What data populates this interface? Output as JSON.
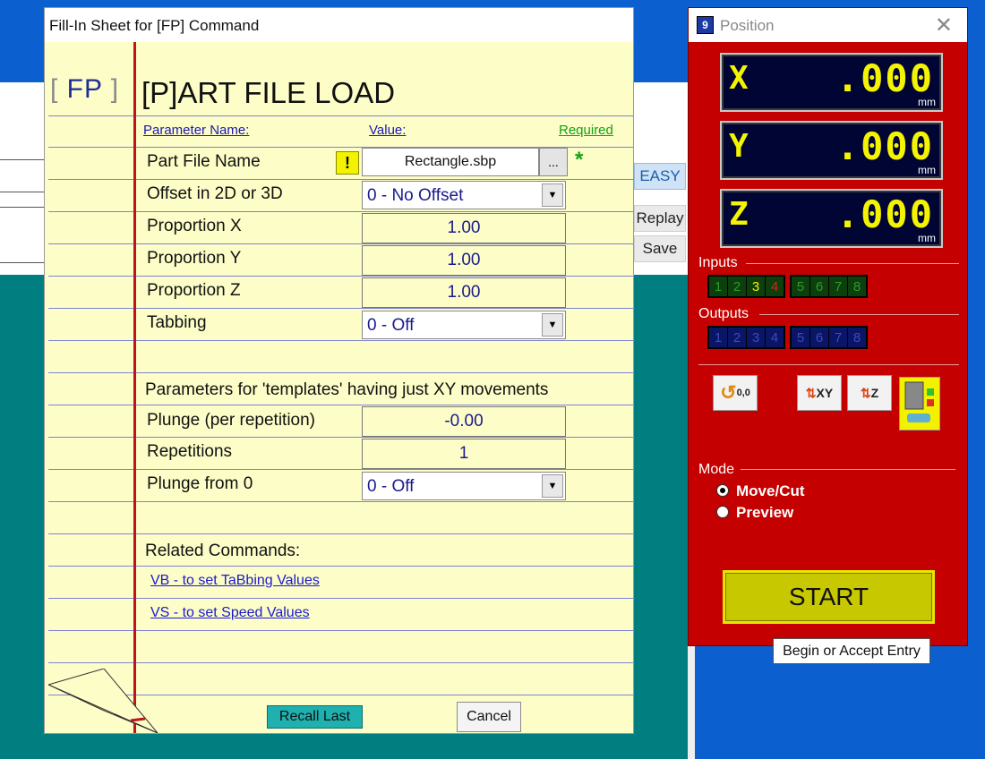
{
  "background_app": {
    "buttons": [
      "EASY",
      "Replay",
      "Save"
    ]
  },
  "fill_in": {
    "window_title": "Fill-In Sheet for [FP] Command",
    "tag": "FP",
    "heading": "[P]ART FILE LOAD",
    "columns": {
      "parameter": "Parameter Name:",
      "value": "Value:",
      "required": "Required"
    },
    "part_file": {
      "label": "Part File Name",
      "value": "Rectangle.sbp",
      "browse": "...",
      "required_mark": "*",
      "warning": "!"
    },
    "offset": {
      "label": "Offset in 2D or 3D",
      "value": "0 - No Offset"
    },
    "proportion_x": {
      "label": "Proportion X",
      "value": "1.00"
    },
    "proportion_y": {
      "label": "Proportion Y",
      "value": "1.00"
    },
    "proportion_z": {
      "label": "Proportion Z",
      "value": "1.00"
    },
    "tabbing": {
      "label": "Tabbing",
      "value": "0 - Off"
    },
    "templates_note": "Parameters for 'templates' having just XY movements",
    "plunge": {
      "label": "Plunge (per repetition)",
      "value": "-0.00"
    },
    "repetitions": {
      "label": "Repetitions",
      "value": "1"
    },
    "plunge_from_0": {
      "label": "Plunge from 0",
      "value": "0 - Off"
    },
    "related_heading": "Related Commands:",
    "links": [
      "VB - to set TaBbing Values",
      "VS - to set Speed Values"
    ],
    "recall_button": "Recall Last",
    "cancel_button": "Cancel"
  },
  "position": {
    "window_title": "Position",
    "app_icon_glyph": "9",
    "close_glyph": "✕",
    "axes": [
      {
        "axis": "X",
        "value": ".000",
        "unit": "mm"
      },
      {
        "axis": "Y",
        "value": ".000",
        "unit": "mm"
      },
      {
        "axis": "Z",
        "value": ".000",
        "unit": "mm"
      }
    ],
    "inputs_label": "Inputs",
    "inputs": [
      "1",
      "2",
      "3",
      "4",
      "5",
      "6",
      "7",
      "8"
    ],
    "active_input_on": "3",
    "active_input_alarm": "4",
    "outputs_label": "Outputs",
    "outputs": [
      "1",
      "2",
      "3",
      "4",
      "5",
      "6",
      "7",
      "8"
    ],
    "tool_buttons": {
      "zero": "0,0",
      "xy": "XY",
      "z": "Z"
    },
    "mode_label": "Mode",
    "modes": [
      {
        "label": "Move/Cut",
        "selected": true
      },
      {
        "label": "Preview",
        "selected": false
      }
    ],
    "start_button": "START"
  },
  "tooltip": "Begin or Accept Entry",
  "colors": {
    "desktop": "#0b5fcf",
    "sheet_paper": "#fdfdc8",
    "margin_red": "#c0141b",
    "position_panel": "#c40000",
    "dro_digits": "#f4f300",
    "start_button": "#c8c800"
  }
}
